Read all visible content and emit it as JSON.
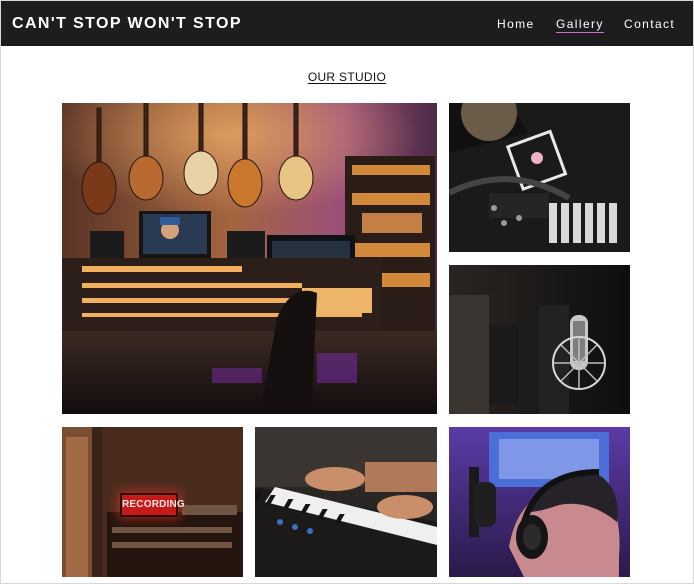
{
  "header": {
    "brand": "CAN'T STOP WON'T STOP",
    "nav": [
      {
        "label": "Home",
        "active": false
      },
      {
        "label": "Gallery",
        "active": true
      },
      {
        "label": "Contact",
        "active": false
      }
    ],
    "background_color": "#1d1d1f",
    "active_underline_color": "#d46bc8"
  },
  "section": {
    "title": "OUR STUDIO"
  },
  "gallery": {
    "images": [
      {
        "name": "studio-control-room-photo"
      },
      {
        "name": "mixer-controller-photo"
      },
      {
        "name": "condenser-microphone-photo"
      },
      {
        "name": "recording-sign-photo",
        "sign_text": "RECORDING"
      },
      {
        "name": "piano-keyboard-photo"
      },
      {
        "name": "headphones-producer-photo"
      }
    ]
  }
}
